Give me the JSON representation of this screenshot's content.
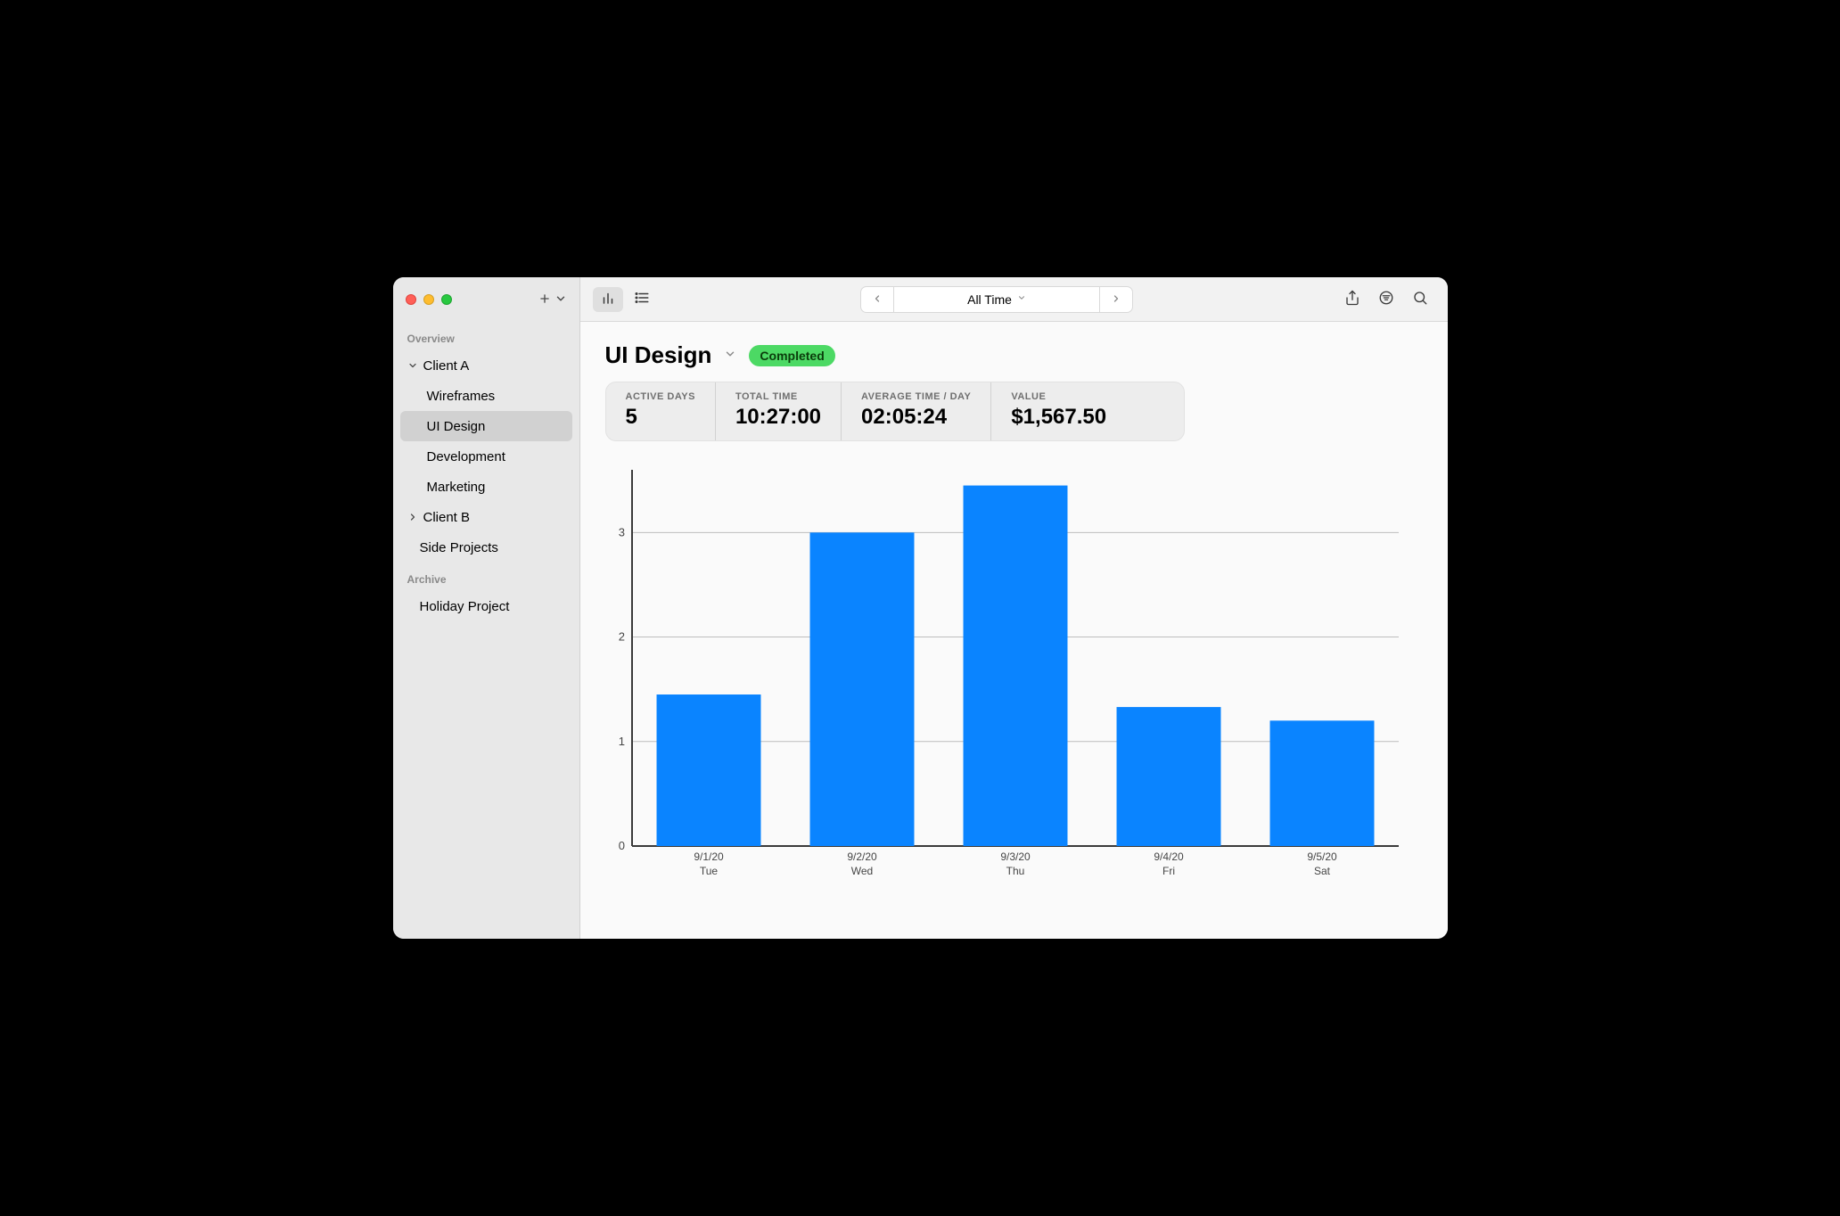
{
  "sidebar": {
    "sections": [
      {
        "label": "Overview",
        "items": [
          {
            "name": "client-a",
            "label": "Client A",
            "expandable": true,
            "expanded": true,
            "children": [
              {
                "name": "wireframes",
                "label": "Wireframes"
              },
              {
                "name": "ui-design",
                "label": "UI Design",
                "selected": true
              },
              {
                "name": "development",
                "label": "Development"
              },
              {
                "name": "marketing",
                "label": "Marketing"
              }
            ]
          },
          {
            "name": "client-b",
            "label": "Client B",
            "expandable": true,
            "expanded": false
          },
          {
            "name": "side-projects",
            "label": "Side Projects"
          }
        ]
      },
      {
        "label": "Archive",
        "items": [
          {
            "name": "holiday-project",
            "label": "Holiday Project"
          }
        ]
      }
    ]
  },
  "toolbar": {
    "range_label": "All Time"
  },
  "page": {
    "title": "UI Design",
    "status": "Completed",
    "status_color": "#4cd964",
    "stats": [
      {
        "label": "ACTIVE DAYS",
        "value": "5"
      },
      {
        "label": "TOTAL TIME",
        "value": "10:27:00"
      },
      {
        "label": "AVERAGE TIME / DAY",
        "value": "02:05:24"
      },
      {
        "label": "VALUE",
        "value": "$1,567.50"
      }
    ]
  },
  "chart_data": {
    "type": "bar",
    "title": "",
    "xlabel": "",
    "ylabel": "",
    "ylim": [
      0,
      3.6
    ],
    "yticks": [
      0,
      1,
      2,
      3
    ],
    "categories": [
      "9/1/20",
      "9/2/20",
      "9/3/20",
      "9/4/20",
      "9/5/20"
    ],
    "category_sub": [
      "Tue",
      "Wed",
      "Thu",
      "Fri",
      "Sat"
    ],
    "values": [
      1.45,
      3.0,
      3.45,
      1.33,
      1.2
    ],
    "bar_color": "#0a84ff"
  }
}
